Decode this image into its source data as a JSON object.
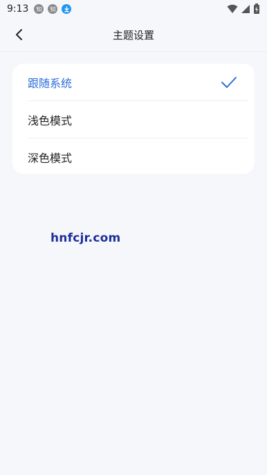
{
  "status_bar": {
    "time": "9:13",
    "notifications": [
      "知",
      "知",
      "download-icon"
    ]
  },
  "header": {
    "back_icon": "chevron-left-icon",
    "title": "主题设置"
  },
  "theme_options": [
    {
      "label": "跟随系统",
      "selected": true
    },
    {
      "label": "浅色模式",
      "selected": false
    },
    {
      "label": "深色模式",
      "selected": false
    }
  ],
  "colors": {
    "accent": "#2b6ed9",
    "background": "#f6f7fb",
    "card": "#ffffff"
  },
  "watermark": "hnfcjr.com"
}
